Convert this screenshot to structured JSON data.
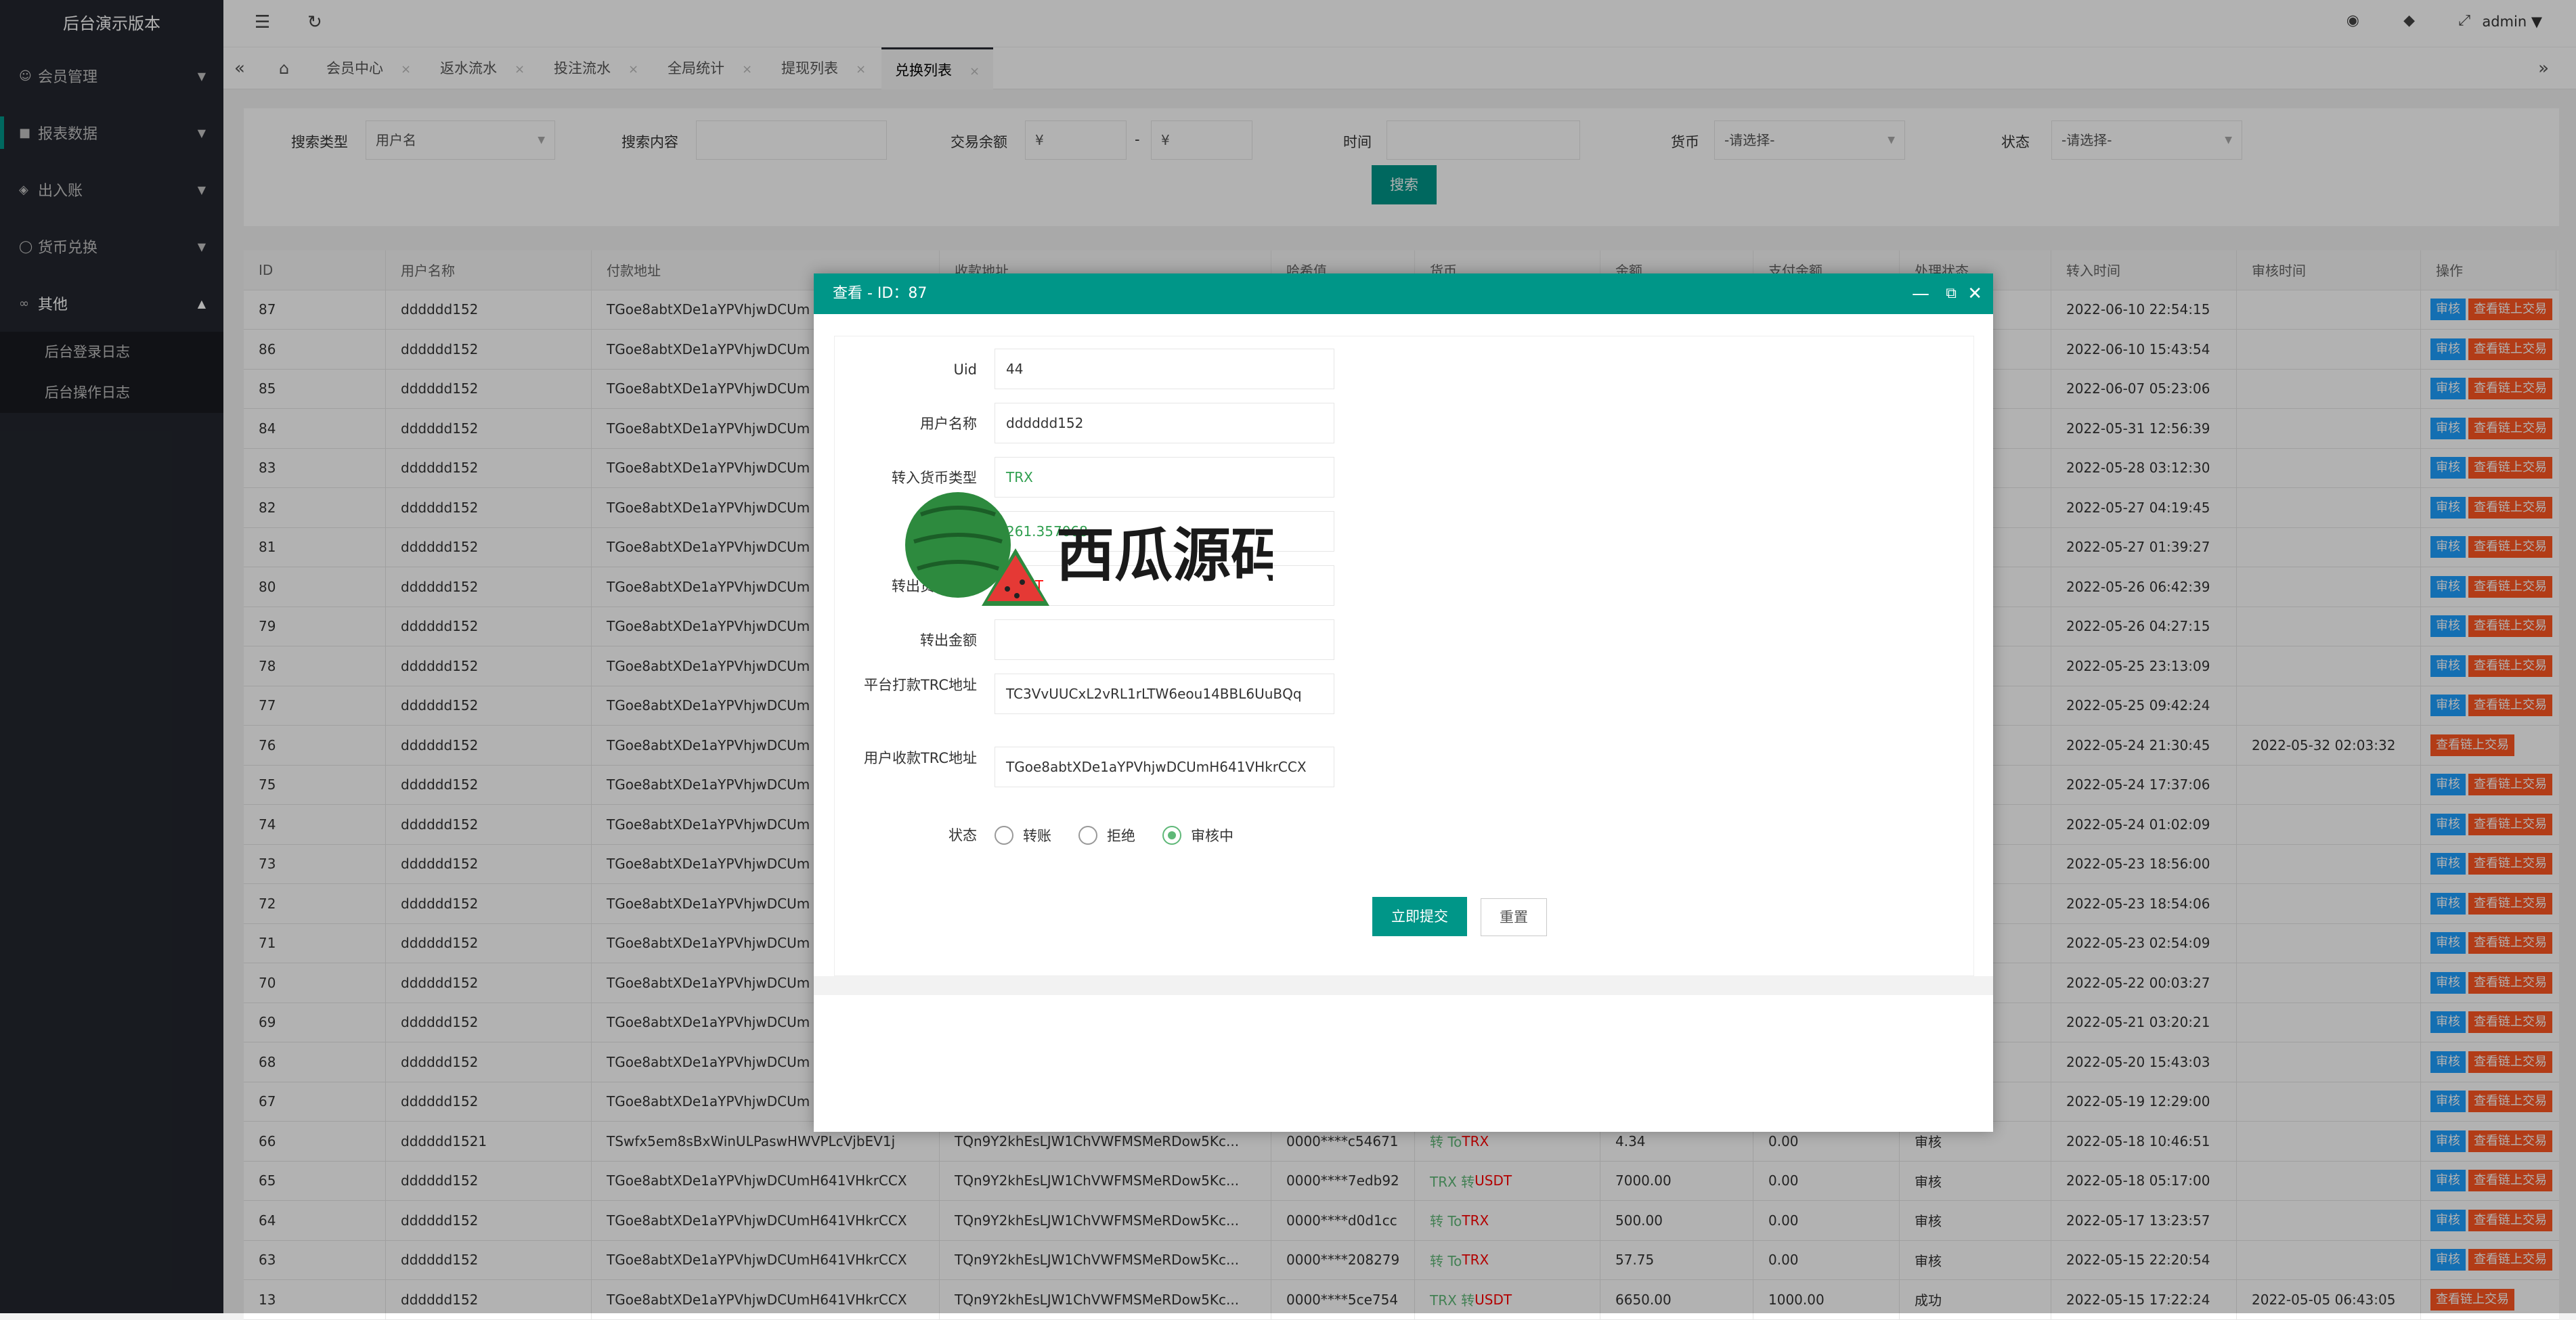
{
  "sidebar": {
    "brand": "后台演示版本",
    "items": [
      {
        "label": "会员管理",
        "icon": "user-icon"
      },
      {
        "label": "报表数据",
        "icon": "chart-icon"
      },
      {
        "label": "出入账",
        "icon": "car-icon"
      },
      {
        "label": "货币兑换",
        "icon": "coin-icon"
      },
      {
        "label": "其他",
        "icon": "link-icon"
      }
    ],
    "subitems": [
      "后台登录日志",
      "后台操作日志"
    ]
  },
  "topbar": {
    "user": "admin"
  },
  "tabs": [
    "会员中心",
    "返水流水",
    "投注流水",
    "全局统计",
    "提现列表",
    "兑换列表"
  ],
  "search": {
    "type_label": "搜索类型",
    "type_value": "用户名",
    "content_label": "搜索内容",
    "balance_label": "交易余额",
    "currency_symbol": "¥",
    "dash": "-",
    "time_label": "时间",
    "currency_label": "货币",
    "currency_placeholder": "-请选择-",
    "status_label": "状态",
    "status_placeholder": "-请选择-",
    "button": "搜索"
  },
  "grid": {
    "headers": [
      "ID",
      "用户名称",
      "付款地址",
      "收款地址",
      "哈希值",
      "货币",
      "金额",
      "支付金额",
      "处理状态",
      "转入时间",
      "审核时间",
      "操作"
    ],
    "btn_review": "审核",
    "btn_chain": "查看链上交易",
    "rows": [
      {
        "id": "87",
        "user": "dddddd152",
        "pay": "TGoe8abtXDe1aYPVhjwDCUm",
        "time": "2022-06-10 22:54:15",
        "audit": "",
        "review": true
      },
      {
        "id": "86",
        "user": "dddddd152",
        "pay": "TGoe8abtXDe1aYPVhjwDCUm",
        "time": "2022-06-10 15:43:54",
        "audit": "",
        "review": true
      },
      {
        "id": "85",
        "user": "dddddd152",
        "pay": "TGoe8abtXDe1aYPVhjwDCUm",
        "time": "2022-06-07 05:23:06",
        "audit": "",
        "review": true
      },
      {
        "id": "84",
        "user": "dddddd152",
        "pay": "TGoe8abtXDe1aYPVhjwDCUm",
        "time": "2022-05-31 12:56:39",
        "audit": "",
        "review": true
      },
      {
        "id": "83",
        "user": "dddddd152",
        "pay": "TGoe8abtXDe1aYPVhjwDCUm",
        "time": "2022-05-28 03:12:30",
        "audit": "",
        "review": true
      },
      {
        "id": "82",
        "user": "dddddd152",
        "pay": "TGoe8abtXDe1aYPVhjwDCUm",
        "time": "2022-05-27 04:19:45",
        "audit": "",
        "review": true
      },
      {
        "id": "81",
        "user": "dddddd152",
        "pay": "TGoe8abtXDe1aYPVhjwDCUm",
        "time": "2022-05-27 01:39:27",
        "audit": "",
        "review": true
      },
      {
        "id": "80",
        "user": "dddddd152",
        "pay": "TGoe8abtXDe1aYPVhjwDCUm",
        "time": "2022-05-26 06:42:39",
        "audit": "",
        "review": true
      },
      {
        "id": "79",
        "user": "dddddd152",
        "pay": "TGoe8abtXDe1aYPVhjwDCUm",
        "time": "2022-05-26 04:27:15",
        "audit": "",
        "review": true
      },
      {
        "id": "78",
        "user": "dddddd152",
        "pay": "TGoe8abtXDe1aYPVhjwDCUm",
        "time": "2022-05-25 23:13:09",
        "audit": "",
        "review": true
      },
      {
        "id": "77",
        "user": "dddddd152",
        "pay": "TGoe8abtXDe1aYPVhjwDCUm",
        "time": "2022-05-25 09:42:24",
        "audit": "",
        "review": true
      },
      {
        "id": "76",
        "user": "dddddd152",
        "pay": "TGoe8abtXDe1aYPVhjwDCUm",
        "time": "2022-05-24 21:30:45",
        "audit": "2022-05-32 02:03:32",
        "review": false
      },
      {
        "id": "75",
        "user": "dddddd152",
        "pay": "TGoe8abtXDe1aYPVhjwDCUm",
        "time": "2022-05-24 17:37:06",
        "audit": "",
        "review": true
      },
      {
        "id": "74",
        "user": "dddddd152",
        "pay": "TGoe8abtXDe1aYPVhjwDCUm",
        "time": "2022-05-24 01:02:09",
        "audit": "",
        "review": true
      },
      {
        "id": "73",
        "user": "dddddd152",
        "pay": "TGoe8abtXDe1aYPVhjwDCUm",
        "time": "2022-05-23 18:56:00",
        "audit": "",
        "review": true
      },
      {
        "id": "72",
        "user": "dddddd152",
        "pay": "TGoe8abtXDe1aYPVhjwDCUm",
        "time": "2022-05-23 18:54:06",
        "audit": "",
        "review": true
      },
      {
        "id": "71",
        "user": "dddddd152",
        "pay": "TGoe8abtXDe1aYPVhjwDCUm",
        "time": "2022-05-23 02:54:09",
        "audit": "",
        "review": true
      },
      {
        "id": "70",
        "user": "dddddd152",
        "pay": "TGoe8abtXDe1aYPVhjwDCUm",
        "time": "2022-05-22 00:03:27",
        "audit": "",
        "review": true
      },
      {
        "id": "69",
        "user": "dddddd152",
        "pay": "TGoe8abtXDe1aYPVhjwDCUm",
        "time": "2022-05-21 03:20:21",
        "audit": "",
        "review": true
      },
      {
        "id": "68",
        "user": "dddddd152",
        "pay": "TGoe8abtXDe1aYPVhjwDCUm",
        "time": "2022-05-20 15:43:03",
        "audit": "",
        "review": true
      },
      {
        "id": "67",
        "user": "dddddd152",
        "pay": "TGoe8abtXDe1aYPVhjwDCUm",
        "time": "2022-05-19 12:29:00",
        "audit": "",
        "review": true
      },
      {
        "id": "66",
        "user": "dddddd1521",
        "pay": "TSwfx5em8sBxWinULPaswHWVPLcVjbEV1j",
        "recv": "TQn9Y2khEsLJW1ChVWFMSMeRDow5Kc...",
        "hash": "0000****c54671",
        "cur_a": "转 To ",
        "cur_b": "TRX",
        "amount": "4.34",
        "paid": "0.00",
        "status": "审核",
        "time": "2022-05-18 10:46:51",
        "audit": "",
        "review": true
      },
      {
        "id": "65",
        "user": "dddddd152",
        "pay": "TGoe8abtXDe1aYPVhjwDCUmH641VHkrCCX",
        "recv": "TQn9Y2khEsLJW1ChVWFMSMeRDow5Kc...",
        "hash": "0000****7edb92",
        "cur_a": "TRX 转 ",
        "cur_b": "USDT",
        "amount": "7000.00",
        "paid": "0.00",
        "status": "审核",
        "time": "2022-05-18 05:17:00",
        "audit": "",
        "review": true
      },
      {
        "id": "64",
        "user": "dddddd152",
        "pay": "TGoe8abtXDe1aYPVhjwDCUmH641VHkrCCX",
        "recv": "TQn9Y2khEsLJW1ChVWFMSMeRDow5Kc...",
        "hash": "0000****d0d1cc",
        "cur_a": "转 To ",
        "cur_b": "TRX",
        "amount": "500.00",
        "paid": "0.00",
        "status": "审核",
        "time": "2022-05-17 13:23:57",
        "audit": "",
        "review": true
      },
      {
        "id": "63",
        "user": "dddddd152",
        "pay": "TGoe8abtXDe1aYPVhjwDCUmH641VHkrCCX",
        "recv": "TQn9Y2khEsLJW1ChVWFMSMeRDow5Kc...",
        "hash": "0000****208279",
        "cur_a": "转 To ",
        "cur_b": "TRX",
        "amount": "57.75",
        "paid": "0.00",
        "status": "审核",
        "time": "2022-05-15 22:20:54",
        "audit": "",
        "review": true
      },
      {
        "id": "13",
        "user": "dddddd152",
        "pay": "TGoe8abtXDe1aYPVhjwDCUmH641VHkrCCX",
        "recv": "TQn9Y2khEsLJW1ChVWFMSMeRDow5Kc...",
        "hash": "0000****5ce754",
        "cur_a": "TRX 转 ",
        "cur_b": "USDT",
        "amount": "6650.00",
        "paid": "1000.00",
        "status": "成功",
        "time": "2022-05-15 17:22:24",
        "audit": "2022-05-05 06:43:05",
        "review": false
      }
    ]
  },
  "dialog": {
    "title": "查看 - ID：87",
    "fields": [
      {
        "label": "Uid",
        "value": "44"
      },
      {
        "label": "用户名称",
        "value": "dddddd152"
      },
      {
        "label": "转入货币类型",
        "value": "TRX"
      },
      {
        "label": "",
        "value": "261.357068"
      },
      {
        "label": "转出货币类型",
        "value": "USDT"
      },
      {
        "label": "转出金额",
        "value": ""
      },
      {
        "label": "平台打款TRC地址",
        "value": "TC3VvUUCxL2vRL1rLTW6eou14BBL6UuBQq"
      },
      {
        "label": "用户收款TRC地址",
        "value": "TGoe8abtXDe1aYPVhjwDCUmH641VHkrCCX"
      }
    ],
    "status_label": "状态",
    "radios": [
      {
        "label": "转账",
        "checked": false
      },
      {
        "label": "拒绝",
        "checked": false
      },
      {
        "label": "审核中",
        "checked": true
      }
    ],
    "submit": "立即提交",
    "reset": "重置"
  },
  "watermark": {
    "text": "西瓜源码"
  },
  "colors": {
    "accent": "#009688",
    "sidebar": "#23262e",
    "blue": "#1e9fff",
    "orange": "#ff5722"
  }
}
